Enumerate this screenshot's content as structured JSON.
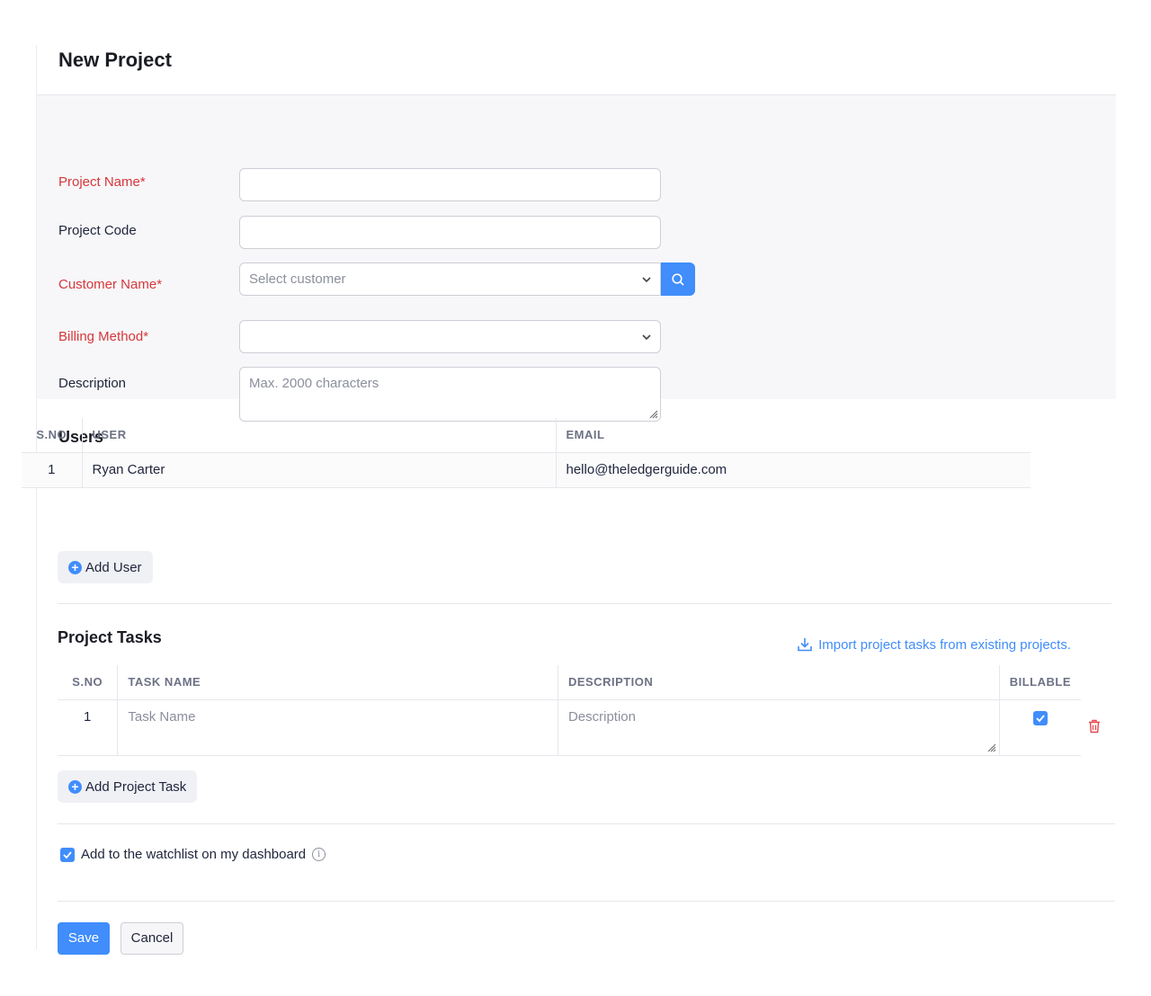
{
  "page": {
    "title": "New Project"
  },
  "form": {
    "project_name": {
      "label": "Project Name*",
      "value": ""
    },
    "project_code": {
      "label": "Project Code",
      "value": ""
    },
    "customer_name": {
      "label": "Customer Name*",
      "placeholder": "Select customer"
    },
    "billing_method": {
      "label": "Billing Method*",
      "value": ""
    },
    "description": {
      "label": "Description",
      "placeholder": "Max. 2000 characters"
    }
  },
  "users": {
    "title": "Users",
    "columns": [
      "S.NO",
      "USER",
      "EMAIL"
    ],
    "rows": [
      {
        "sno": "1",
        "user": "Ryan Carter",
        "email": "hello@theledgerguide.com"
      }
    ],
    "add_label": "Add User"
  },
  "tasks": {
    "title": "Project Tasks",
    "import_label": "Import project tasks from existing projects.",
    "columns": [
      "S.NO",
      "TASK NAME",
      "DESCRIPTION",
      "BILLABLE"
    ],
    "rows": [
      {
        "sno": "1",
        "task_placeholder": "Task Name",
        "description_placeholder": "Description",
        "billable": true
      }
    ],
    "add_label": "Add Project Task"
  },
  "watchlist": {
    "label": "Add to the watchlist on my dashboard",
    "checked": true
  },
  "actions": {
    "save": "Save",
    "cancel": "Cancel"
  },
  "colors": {
    "accent": "#408dfb",
    "required": "#d6373b",
    "danger": "#e5484d"
  }
}
